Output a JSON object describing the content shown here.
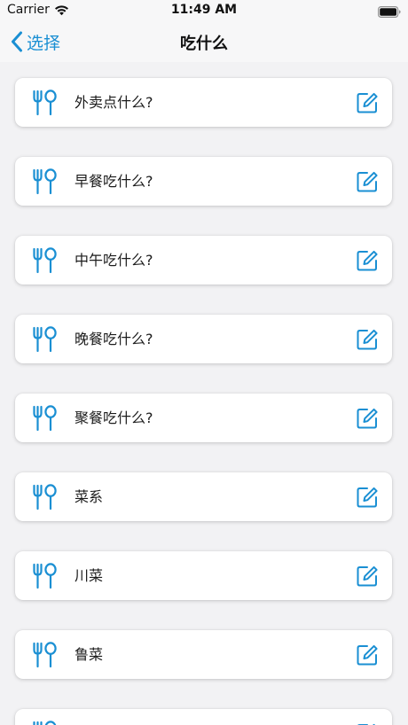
{
  "status_bar": {
    "carrier": "Carrier",
    "time": "11:49 AM"
  },
  "nav": {
    "back_label": "选择",
    "title": "吃什么"
  },
  "colors": {
    "accent": "#1a8fd3",
    "background": "#f2f2f4",
    "card": "#ffffff"
  },
  "items": [
    {
      "label": "外卖点什么?",
      "icon": "fork-spoon-icon",
      "action_icon": "edit-icon"
    },
    {
      "label": "早餐吃什么?",
      "icon": "fork-spoon-icon",
      "action_icon": "edit-icon"
    },
    {
      "label": "中午吃什么?",
      "icon": "fork-spoon-icon",
      "action_icon": "edit-icon"
    },
    {
      "label": "晚餐吃什么?",
      "icon": "fork-spoon-icon",
      "action_icon": "edit-icon"
    },
    {
      "label": "聚餐吃什么?",
      "icon": "fork-spoon-icon",
      "action_icon": "edit-icon"
    },
    {
      "label": "菜系",
      "icon": "fork-spoon-icon",
      "action_icon": "edit-icon"
    },
    {
      "label": "川菜",
      "icon": "fork-spoon-icon",
      "action_icon": "edit-icon"
    },
    {
      "label": "鲁菜",
      "icon": "fork-spoon-icon",
      "action_icon": "edit-icon"
    },
    {
      "label": "",
      "icon": "fork-spoon-icon",
      "action_icon": "edit-icon"
    }
  ]
}
